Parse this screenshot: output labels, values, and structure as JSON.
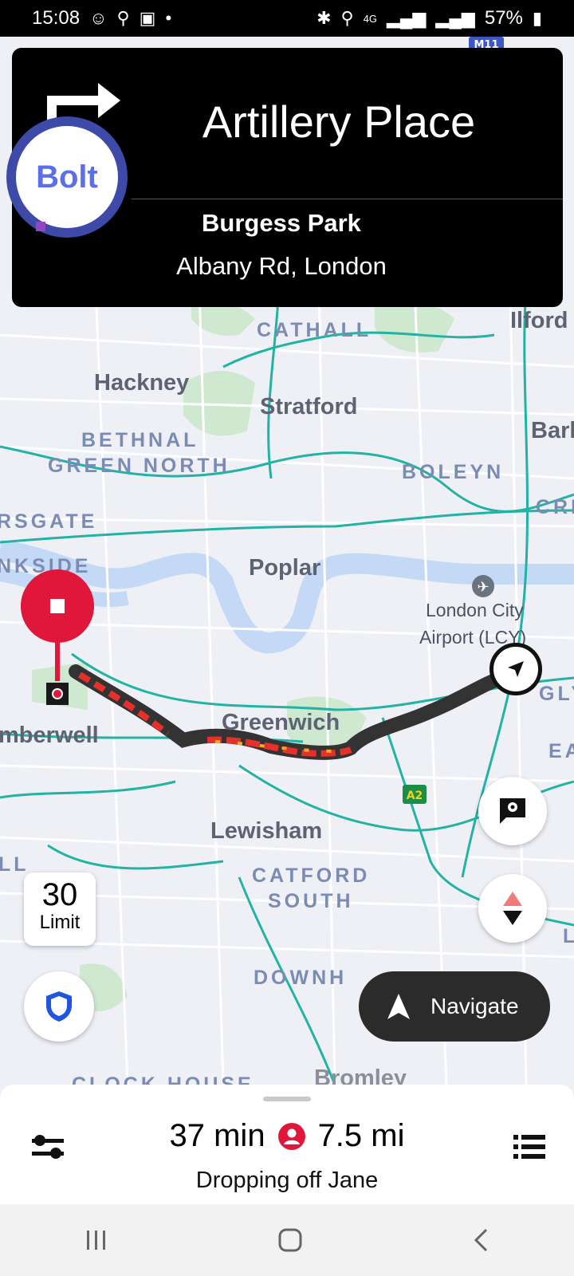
{
  "status_bar": {
    "time": "15:08",
    "left_icons": [
      "whatsapp-icon",
      "location-pin-icon",
      "gallery-icon",
      "dot-icon"
    ],
    "right_icons": [
      "bluetooth-icon",
      "location-icon",
      "4g-icon",
      "signal-icon",
      "signal-icon",
      "battery-icon"
    ],
    "network": "4G",
    "battery": "57%"
  },
  "map": {
    "places": {
      "hackney": "Hackney",
      "stratford": "Stratford",
      "poplar": "Poplar",
      "greenwich": "Greenwich",
      "lewisham": "Lewisham",
      "ilford": "Ilford",
      "bark": "Bark",
      "camberwell": "mberwell",
      "bromley": "Bromley"
    },
    "districts": {
      "cathall": "CATHALL",
      "bethnal": "BETHNAL",
      "green_north": "GREEN NORTH",
      "boleyn": "BOLEYN",
      "bishopsgate": "RSGATE",
      "bankside": "NKSIDE",
      "cre": "CRE",
      "ll": "LL",
      "catford": "CATFORD",
      "south": "SOUTH",
      "downham": "DOWNH",
      "clock_house": "CLOCK HOUSE",
      "glyn": "GLYN",
      "eas": "EAS",
      "l": "L"
    },
    "poi": {
      "airport_line1": "London City",
      "airport_line2": "Airport (LCY)"
    },
    "road_badges": {
      "a2": "A2",
      "m11": "M11"
    },
    "route_color": "#333333",
    "traffic_colors": [
      "#e8302a",
      "#f5a623"
    ]
  },
  "instruction": {
    "maneuver": "turn-right-icon",
    "street": "Artillery Place",
    "destination_name": "Burgess Park",
    "destination_address": "Albany Rd, London"
  },
  "brand": {
    "logo_text": "Bolt",
    "color": "#5d6fe8"
  },
  "speed_limit": {
    "value": "30",
    "label": "Limit"
  },
  "navigate_button": {
    "label": "Navigate"
  },
  "trip": {
    "eta": "37 min",
    "distance": "7.5 mi",
    "status": "Dropping off Jane"
  },
  "colors": {
    "accent_red": "#e0173a",
    "shield_blue": "#1f55e0"
  }
}
